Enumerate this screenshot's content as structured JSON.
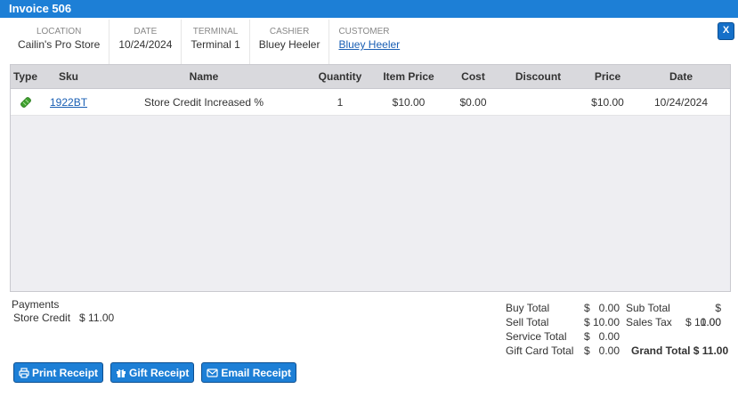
{
  "title": "Invoice 506",
  "close_label": "X",
  "info": {
    "location_label": "LOCATION",
    "location": "Cailin's Pro Store",
    "date_label": "DATE",
    "date": "10/24/2024",
    "terminal_label": "TERMINAL",
    "terminal": "Terminal 1",
    "cashier_label": "CASHIER",
    "cashier": "Bluey Heeler",
    "customer_label": "CUSTOMER",
    "customer": "Bluey Heeler"
  },
  "table": {
    "headers": [
      "Type",
      "Sku",
      "Name",
      "Quantity",
      "Item Price",
      "Cost",
      "Discount",
      "Price",
      "Date"
    ],
    "rows": [
      {
        "type_icon": "tag-icon",
        "sku": "1922BT",
        "name": "Store Credit Increased %",
        "quantity": "1",
        "item_price": "$10.00",
        "cost": "$0.00",
        "discount": "",
        "price": "$10.00",
        "date": "10/24/2024"
      }
    ]
  },
  "payments": {
    "title": "Payments",
    "items": [
      {
        "method": "Store Credit",
        "amount": "$ 11.00"
      }
    ]
  },
  "totals": {
    "buy_total_label": "Buy Total",
    "buy_total": "$   0.00",
    "sell_total_label": "Sell Total",
    "sell_total": "$ 10.00",
    "service_total_label": "Service Total",
    "service_total": "$   0.00",
    "gift_card_total_label": "Gift Card Total",
    "gift_card_total": "$   0.00",
    "sub_total_label": "Sub Total",
    "sub_total": "$ 10.00",
    "sales_tax_label": "Sales Tax",
    "sales_tax": "$   1.00",
    "grand_total": "Grand Total $ 11.00"
  },
  "actions": {
    "print_receipt": "Print Receipt",
    "gift_receipt": "Gift Receipt",
    "email_receipt": "Email Receipt"
  },
  "colors": {
    "title_bar": "#1d7fd6",
    "button": "#1d7fd6",
    "link": "#1a5fb4",
    "tag_icon": "#3fa02e"
  }
}
